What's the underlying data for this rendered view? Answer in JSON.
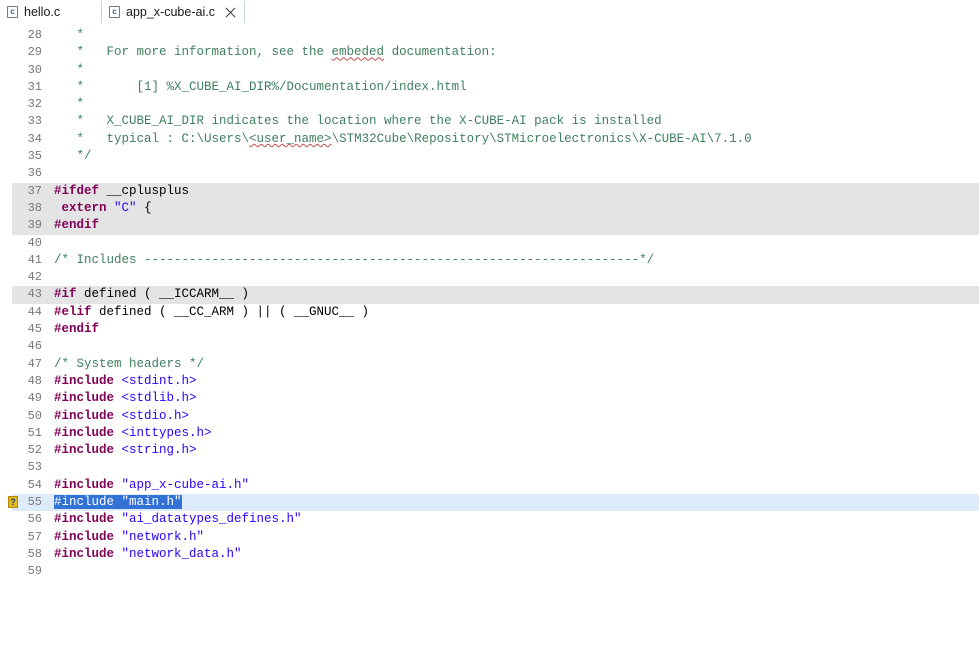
{
  "tabs": [
    {
      "name": "hello.c",
      "icon": "c-file-icon",
      "active": false
    },
    {
      "name": "app_x-cube-ai.c",
      "icon": "c-file-icon",
      "active": true
    }
  ],
  "editor": {
    "lines": [
      {
        "n": "28",
        "segs": [
          [
            "cm",
            "   *"
          ]
        ]
      },
      {
        "n": "29",
        "segs": [
          [
            "cm",
            "   *   For more information, see the "
          ],
          [
            "cmsq",
            "embeded"
          ],
          [
            "cm",
            " documentation:"
          ]
        ]
      },
      {
        "n": "30",
        "segs": [
          [
            "cm",
            "   *"
          ]
        ]
      },
      {
        "n": "31",
        "segs": [
          [
            "cm",
            "   *       [1] %X_CUBE_AI_DIR%/Documentation/index.html"
          ]
        ]
      },
      {
        "n": "32",
        "segs": [
          [
            "cm",
            "   *"
          ]
        ]
      },
      {
        "n": "33",
        "segs": [
          [
            "cm",
            "   *   X_CUBE_AI_DIR indicates the location where the X-CUBE-AI pack is installed"
          ]
        ]
      },
      {
        "n": "34",
        "segs": [
          [
            "cm",
            "   *   typical : C:\\Users\\"
          ],
          [
            "cmsq",
            "<user_name>"
          ],
          [
            "cm",
            "\\STM32Cube\\Repository\\STMicroelectronics\\X-CUBE-AI\\7.1.0"
          ]
        ]
      },
      {
        "n": "35",
        "segs": [
          [
            "cm",
            "   */"
          ]
        ]
      },
      {
        "n": "36",
        "segs": []
      },
      {
        "n": "37",
        "hl": true,
        "segs": [
          [
            "kw",
            "#ifdef"
          ],
          [
            "plain",
            " __cplusplus"
          ]
        ]
      },
      {
        "n": "38",
        "hl": true,
        "segs": [
          [
            "plain",
            " "
          ],
          [
            "kw",
            "extern"
          ],
          [
            "plain",
            " "
          ],
          [
            "str",
            "\"C\""
          ],
          [
            "plain",
            " {"
          ]
        ]
      },
      {
        "n": "39",
        "hl": true,
        "segs": [
          [
            "kw",
            "#endif"
          ]
        ]
      },
      {
        "n": "40",
        "segs": []
      },
      {
        "n": "41",
        "segs": [
          [
            "cm",
            "/* Includes ------------------------------------------------------------------*/"
          ]
        ]
      },
      {
        "n": "42",
        "segs": []
      },
      {
        "n": "43",
        "hl": true,
        "segs": [
          [
            "kw",
            "#if"
          ],
          [
            "plain",
            " defined ( __ICCARM__ )"
          ]
        ]
      },
      {
        "n": "44",
        "segs": [
          [
            "kw",
            "#elif"
          ],
          [
            "plain",
            " defined ( __CC_ARM ) || ( __GNUC__ )"
          ]
        ]
      },
      {
        "n": "45",
        "segs": [
          [
            "kw",
            "#endif"
          ]
        ]
      },
      {
        "n": "46",
        "segs": []
      },
      {
        "n": "47",
        "segs": [
          [
            "cm",
            "/* System headers */"
          ]
        ]
      },
      {
        "n": "48",
        "segs": [
          [
            "kw",
            "#include"
          ],
          [
            "plain",
            " "
          ],
          [
            "str",
            "<stdint.h>"
          ]
        ]
      },
      {
        "n": "49",
        "segs": [
          [
            "kw",
            "#include"
          ],
          [
            "plain",
            " "
          ],
          [
            "str",
            "<stdlib.h>"
          ]
        ]
      },
      {
        "n": "50",
        "segs": [
          [
            "kw",
            "#include"
          ],
          [
            "plain",
            " "
          ],
          [
            "str",
            "<stdio.h>"
          ]
        ]
      },
      {
        "n": "51",
        "segs": [
          [
            "kw",
            "#include"
          ],
          [
            "plain",
            " "
          ],
          [
            "str",
            "<inttypes.h>"
          ]
        ]
      },
      {
        "n": "52",
        "segs": [
          [
            "kw",
            "#include"
          ],
          [
            "plain",
            " "
          ],
          [
            "str",
            "<string.h>"
          ]
        ]
      },
      {
        "n": "53",
        "segs": []
      },
      {
        "n": "54",
        "segs": [
          [
            "kw",
            "#include"
          ],
          [
            "plain",
            " "
          ],
          [
            "str",
            "\"app_x-cube-ai.h\""
          ]
        ]
      },
      {
        "n": "55",
        "sel": true,
        "marker": "?",
        "segs": [
          [
            "selected",
            "#include \"main.h\""
          ]
        ]
      },
      {
        "n": "56",
        "segs": [
          [
            "kw",
            "#include"
          ],
          [
            "plain",
            " "
          ],
          [
            "str",
            "\"ai_datatypes_defines.h\""
          ]
        ]
      },
      {
        "n": "57",
        "segs": [
          [
            "kw",
            "#include"
          ],
          [
            "plain",
            " "
          ],
          [
            "str",
            "\"network.h\""
          ]
        ]
      },
      {
        "n": "58",
        "segs": [
          [
            "kw",
            "#include"
          ],
          [
            "plain",
            " "
          ],
          [
            "str",
            "\"network_data.h\""
          ]
        ]
      },
      {
        "n": "59",
        "segs": []
      }
    ]
  },
  "colors": {
    "keyword": "#7f0055",
    "string": "#2a00ff",
    "comment": "#3f7f5f",
    "selection": "#3271d6",
    "current_line": "#ddebfb",
    "inactive_block": "#e4e4e4"
  }
}
